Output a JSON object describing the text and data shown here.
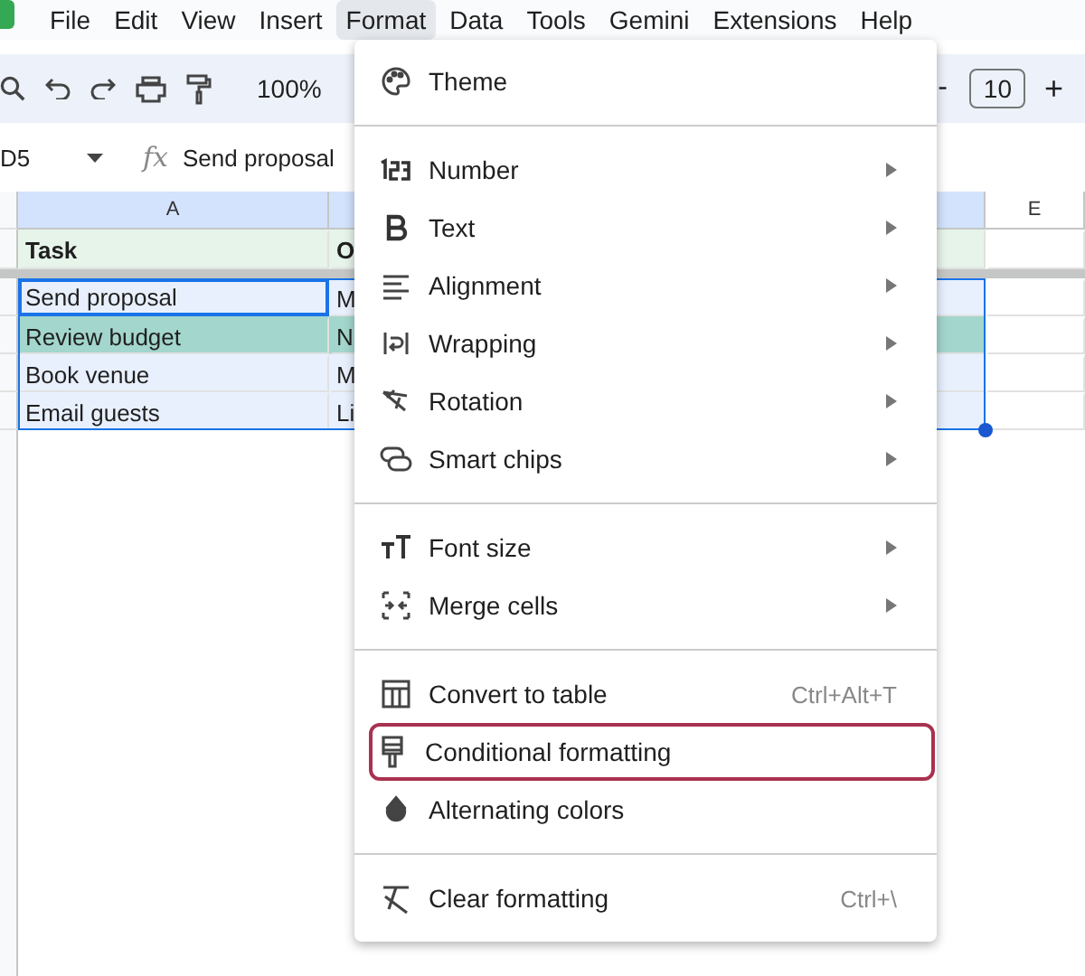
{
  "menubar": {
    "items": [
      {
        "label": "File",
        "selected": false
      },
      {
        "label": "Edit",
        "selected": false
      },
      {
        "label": "View",
        "selected": false
      },
      {
        "label": "Insert",
        "selected": false
      },
      {
        "label": "Format",
        "selected": true
      },
      {
        "label": "Data",
        "selected": false
      },
      {
        "label": "Tools",
        "selected": false
      },
      {
        "label": "Gemini",
        "selected": false
      },
      {
        "label": "Extensions",
        "selected": false
      },
      {
        "label": "Help",
        "selected": false
      }
    ]
  },
  "toolbar": {
    "zoom": "100%",
    "minus": "-",
    "font_size": "10",
    "plus": "+"
  },
  "formula_bar": {
    "cell_ref": "D5",
    "fx": "fx",
    "value": "Send proposal"
  },
  "sheet": {
    "column_headers": [
      "A",
      "E"
    ],
    "header_row": [
      "Task",
      "O"
    ],
    "rows": [
      {
        "cells": [
          "Send proposal",
          "M"
        ],
        "highlighted": false,
        "active": true
      },
      {
        "cells": [
          "Review budget",
          "N"
        ],
        "highlighted": true,
        "active": false
      },
      {
        "cells": [
          "Book venue",
          "M"
        ],
        "highlighted": false,
        "active": false
      },
      {
        "cells": [
          "Email guests",
          "Li"
        ],
        "highlighted": false,
        "active": false
      }
    ]
  },
  "format_menu": {
    "sections": [
      {
        "items": [
          {
            "label": "Theme",
            "submenu": false,
            "selected": false
          }
        ]
      },
      {
        "items": [
          {
            "label": "Number",
            "submenu": true,
            "selected": false
          },
          {
            "label": "Text",
            "submenu": true,
            "selected": false
          },
          {
            "label": "Alignment",
            "submenu": true,
            "selected": false
          },
          {
            "label": "Wrapping",
            "submenu": true,
            "selected": false
          },
          {
            "label": "Rotation",
            "submenu": true,
            "selected": false
          },
          {
            "label": "Smart chips",
            "submenu": true,
            "selected": false
          }
        ]
      },
      {
        "items": [
          {
            "label": "Font size",
            "submenu": true,
            "selected": false
          },
          {
            "label": "Merge cells",
            "submenu": true,
            "selected": false
          }
        ]
      },
      {
        "items": [
          {
            "label": "Convert to table",
            "submenu": false,
            "shortcut": "Ctrl+Alt+T",
            "selected": false
          },
          {
            "label": "Conditional formatting",
            "submenu": false,
            "selected": true
          },
          {
            "label": "Alternating colors",
            "submenu": false,
            "selected": false
          }
        ]
      },
      {
        "items": [
          {
            "label": "Clear formatting",
            "submenu": false,
            "shortcut": "Ctrl+\\",
            "selected": false
          }
        ]
      }
    ]
  }
}
